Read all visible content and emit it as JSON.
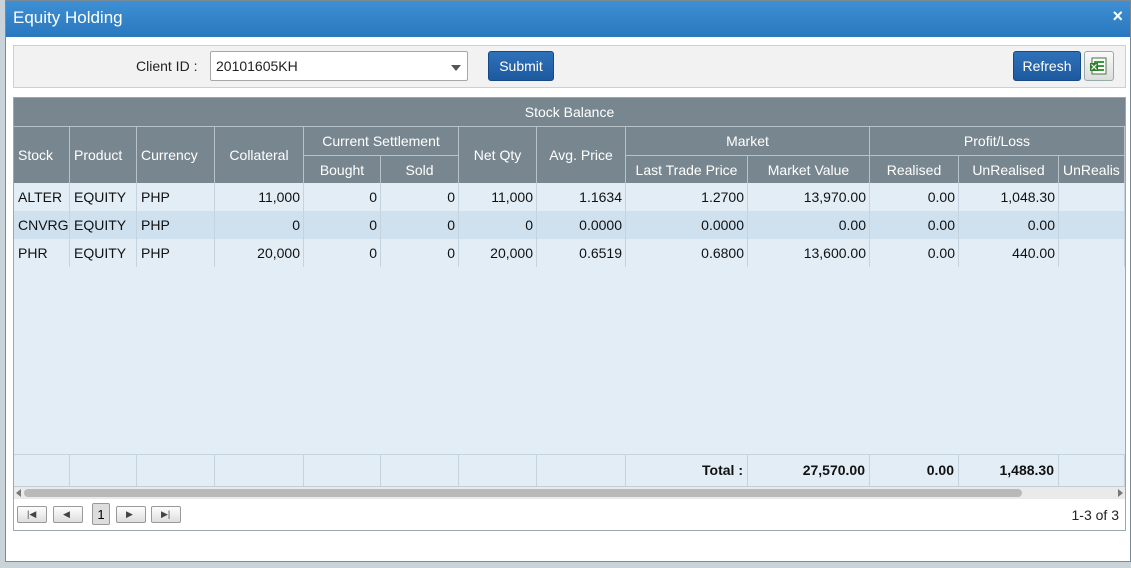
{
  "dialog": {
    "title": "Equity Holding",
    "close_glyph": "×"
  },
  "toolbar": {
    "client_label": "Client ID :",
    "client_value": "20101605KH",
    "submit_label": "Submit",
    "refresh_label": "Refresh"
  },
  "grid": {
    "caption": "Stock Balance",
    "headers": {
      "stock": "Stock",
      "product": "Product",
      "currency": "Currency",
      "collateral": "Collateral",
      "current_settlement": "Current Settlement",
      "bought": "Bought",
      "sold": "Sold",
      "net_qty": "Net Qty",
      "avg_price": "Avg. Price",
      "market": "Market",
      "last_trade_price": "Last Trade Price",
      "market_value": "Market Value",
      "profit_loss": "Profit/Loss",
      "realised": "Realised",
      "unrealised": "UnRealised",
      "unrealised_pct": "UnRealis"
    },
    "rows": [
      {
        "stock": "ALTER",
        "product": "EQUITY",
        "currency": "PHP",
        "collateral": "11,000",
        "bought": "0",
        "sold": "0",
        "net_qty": "11,000",
        "avg_price": "1.1634",
        "last_trade_price": "1.2700",
        "market_value": "13,970.00",
        "realised": "0.00",
        "unrealised": "1,048.30"
      },
      {
        "stock": "CNVRG",
        "product": "EQUITY",
        "currency": "PHP",
        "collateral": "0",
        "bought": "0",
        "sold": "0",
        "net_qty": "0",
        "avg_price": "0.0000",
        "last_trade_price": "0.0000",
        "market_value": "0.00",
        "realised": "0.00",
        "unrealised": "0.00"
      },
      {
        "stock": "PHR",
        "product": "EQUITY",
        "currency": "PHP",
        "collateral": "20,000",
        "bought": "0",
        "sold": "0",
        "net_qty": "20,000",
        "avg_price": "0.6519",
        "last_trade_price": "0.6800",
        "market_value": "13,600.00",
        "realised": "0.00",
        "unrealised": "440.00"
      }
    ],
    "totals": {
      "label": "Total :",
      "market_value": "27,570.00",
      "realised": "0.00",
      "unrealised": "1,488.30"
    }
  },
  "pager": {
    "current_page": "1",
    "records": "1-3 of 3"
  },
  "icons": {
    "close": "close-icon",
    "dropdown": "chevron-down-icon",
    "excel": "excel-export-icon",
    "first": "first-page-icon",
    "prev": "prev-page-icon",
    "next": "next-page-icon",
    "last": "last-page-icon"
  }
}
